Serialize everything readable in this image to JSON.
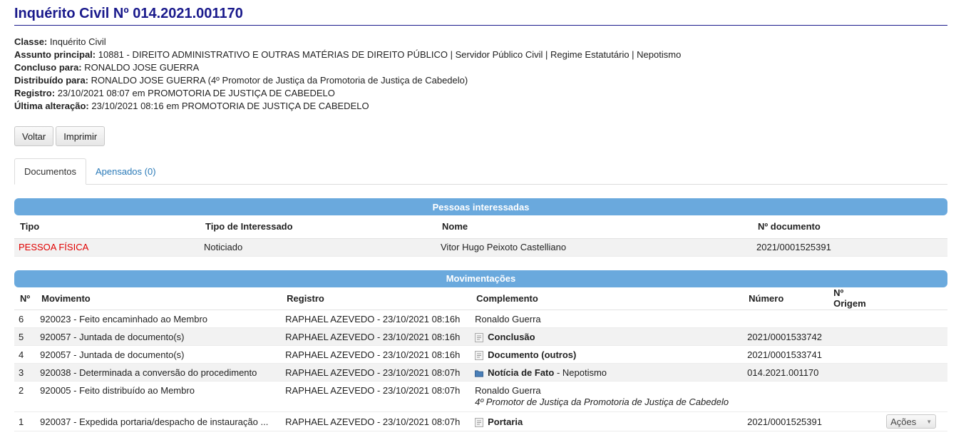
{
  "page_title": "Inquérito Civil Nº 014.2021.001170",
  "meta": [
    {
      "label": "Classe:",
      "value": "Inquérito Civil"
    },
    {
      "label": "Assunto principal:",
      "value": "10881 - DIREITO ADMINISTRATIVO E OUTRAS MATÉRIAS DE DIREITO PÚBLICO | Servidor Público Civil | Regime Estatutário | Nepotismo"
    },
    {
      "label": "Concluso para:",
      "value": "RONALDO JOSE GUERRA"
    },
    {
      "label": "Distribuído para:",
      "value": "RONALDO JOSE GUERRA (4º Promotor de Justiça da Promotoria de Justiça de Cabedelo)"
    },
    {
      "label": "Registro:",
      "value": "23/10/2021 08:07 em PROMOTORIA DE JUSTIÇA DE CABEDELO"
    },
    {
      "label": "Última alteração:",
      "value": "23/10/2021 08:16 em PROMOTORIA DE JUSTIÇA DE CABEDELO"
    }
  ],
  "buttons": {
    "back": "Voltar",
    "print": "Imprimir"
  },
  "tabs": {
    "documents": "Documentos",
    "attached": "Apensados (0)"
  },
  "interested": {
    "title": "Pessoas interessadas",
    "headers": [
      "Tipo",
      "Tipo de Interessado",
      "Nome",
      "Nº documento"
    ],
    "rows": [
      [
        "PESSOA FÍSICA",
        "Noticiado",
        "Vitor Hugo Peixoto Castelliano",
        "2021/0001525391"
      ]
    ]
  },
  "movements": {
    "title": "Movimentações",
    "headers": [
      "Nº",
      "Movimento",
      "Registro",
      "Complemento",
      "Número",
      "Nº Origem"
    ],
    "rows": [
      {
        "n": "6",
        "mov": "920023 - Feito encaminhado ao Membro",
        "reg": "RAPHAEL AZEVEDO - 23/10/2021 08:16h",
        "comp": "Ronaldo Guerra",
        "num": ""
      },
      {
        "n": "5",
        "mov": "920057 - Juntada de documento(s)",
        "reg": "RAPHAEL AZEVEDO - 23/10/2021 08:16h",
        "comp": "Conclusão",
        "num": "2021/0001533742"
      },
      {
        "n": "4",
        "mov": "920057 - Juntada de documento(s)",
        "reg": "RAPHAEL AZEVEDO - 23/10/2021 08:16h",
        "comp": "Documento (outros)",
        "num": "2021/0001533741"
      },
      {
        "n": "3",
        "mov": "920038 - Determinada a conversão do procedimento",
        "reg": "RAPHAEL AZEVEDO - 23/10/2021 08:07h",
        "comp": "Notícia de Fato",
        "comp_suffix": " - Nepotismo",
        "num": "014.2021.001170"
      },
      {
        "n": "2",
        "mov": "920005 - Feito distribuído ao Membro",
        "reg": "RAPHAEL AZEVEDO - 23/10/2021 08:07h",
        "comp": "Ronaldo Guerra",
        "comp_sub": "4º Promotor de Justiça da Promotoria de Justiça de Cabedelo",
        "num": ""
      },
      {
        "n": "1",
        "mov": "920037 - Expedida portaria/despacho de instauração ...",
        "reg": "RAPHAEL AZEVEDO - 23/10/2021 08:07h",
        "comp": "Portaria",
        "num": "2021/0001525391"
      }
    ],
    "actions_label": "Ações"
  }
}
